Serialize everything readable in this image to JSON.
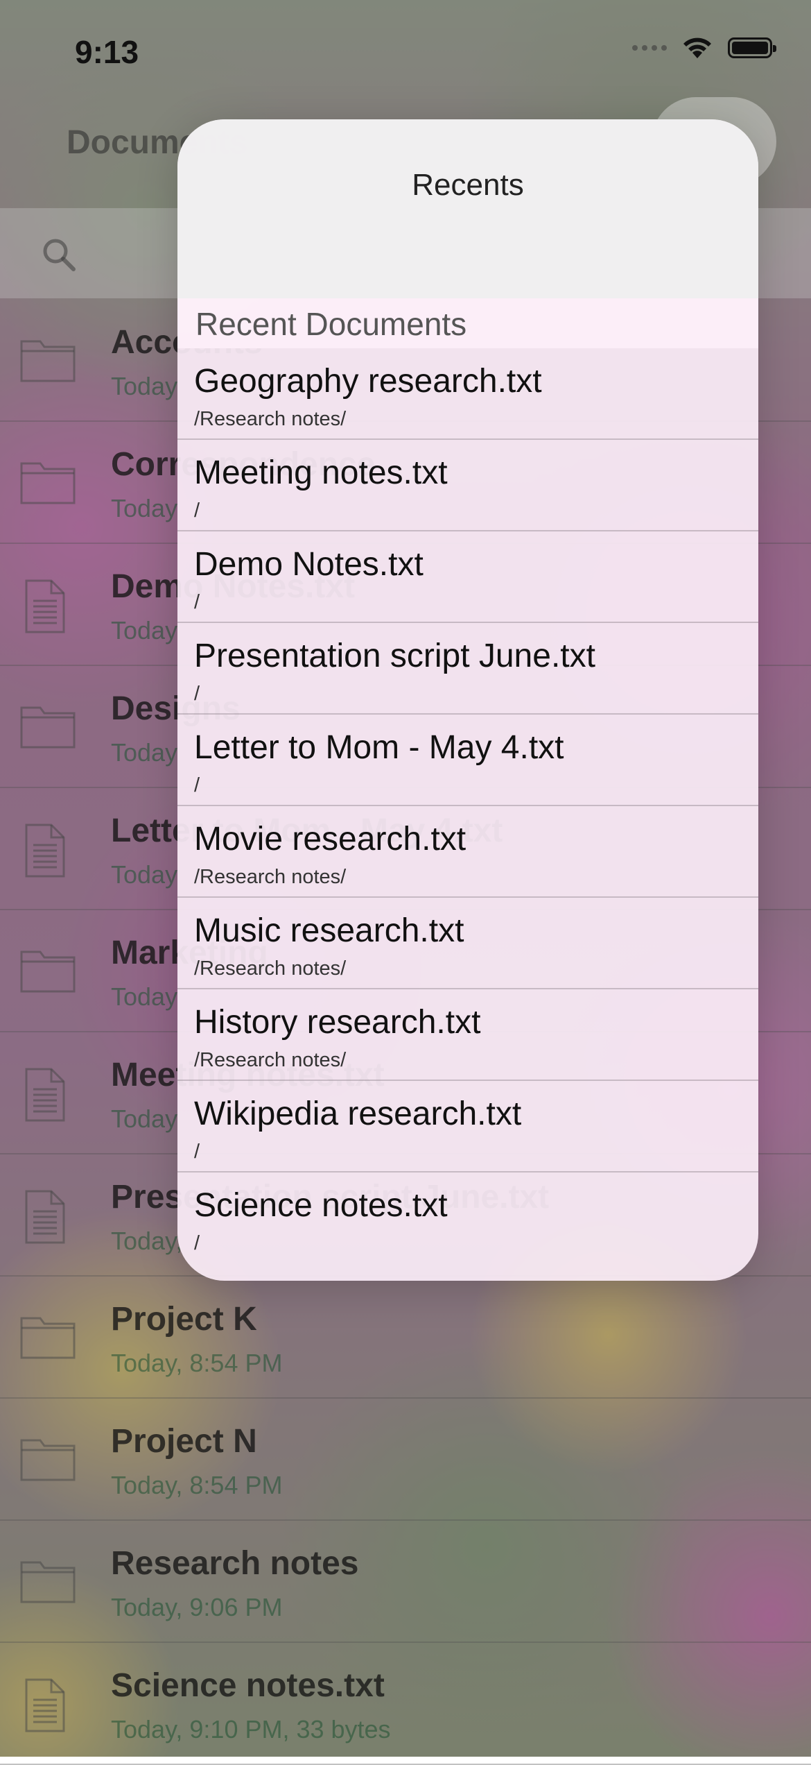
{
  "status_bar": {
    "time": "9:13",
    "wifi_icon": "wifi-icon",
    "battery_icon": "battery-icon"
  },
  "nav": {
    "title": "Documents"
  },
  "search": {
    "icon": "search-icon"
  },
  "documents": [
    {
      "name": "Accounts",
      "meta": "Today",
      "icon": "folder-icon"
    },
    {
      "name": "Correspondence",
      "meta": "Today",
      "icon": "folder-icon"
    },
    {
      "name": "Demo Notes.txt",
      "meta": "Today",
      "icon": "document-icon"
    },
    {
      "name": "Designs",
      "meta": "Today",
      "icon": "folder-icon"
    },
    {
      "name": "Letter to Mom - May 4.txt",
      "meta": "Today",
      "icon": "document-icon"
    },
    {
      "name": "Marketing",
      "meta": "Today",
      "icon": "folder-icon"
    },
    {
      "name": "Meeting notes.txt",
      "meta": "Today",
      "icon": "document-icon"
    },
    {
      "name": "Presentation script June.txt",
      "meta": "Today,",
      "icon": "document-icon"
    },
    {
      "name": "Project K",
      "meta": "Today, 8:54 PM",
      "icon": "folder-icon"
    },
    {
      "name": "Project N",
      "meta": "Today, 8:54 PM",
      "icon": "folder-icon"
    },
    {
      "name": "Research notes",
      "meta": "Today, 9:06 PM",
      "icon": "folder-icon"
    },
    {
      "name": "Science notes.txt",
      "meta": "Today, 9:10 PM, 33 bytes",
      "icon": "document-icon"
    }
  ],
  "popover": {
    "title": "Recents",
    "section_title": "Recent Documents",
    "items": [
      {
        "name": "Geography research.txt",
        "path": "/Research notes/"
      },
      {
        "name": "Meeting notes.txt",
        "path": "/"
      },
      {
        "name": "Demo Notes.txt",
        "path": "/"
      },
      {
        "name": "Presentation script June.txt",
        "path": "/"
      },
      {
        "name": "Letter to Mom - May 4.txt",
        "path": "/"
      },
      {
        "name": "Movie research.txt",
        "path": "/Research notes/"
      },
      {
        "name": "Music research.txt",
        "path": "/Research notes/"
      },
      {
        "name": "History research.txt",
        "path": "/Research notes/"
      },
      {
        "name": "Wikipedia research.txt",
        "path": "/"
      },
      {
        "name": "Science notes.txt",
        "path": "/"
      }
    ]
  }
}
